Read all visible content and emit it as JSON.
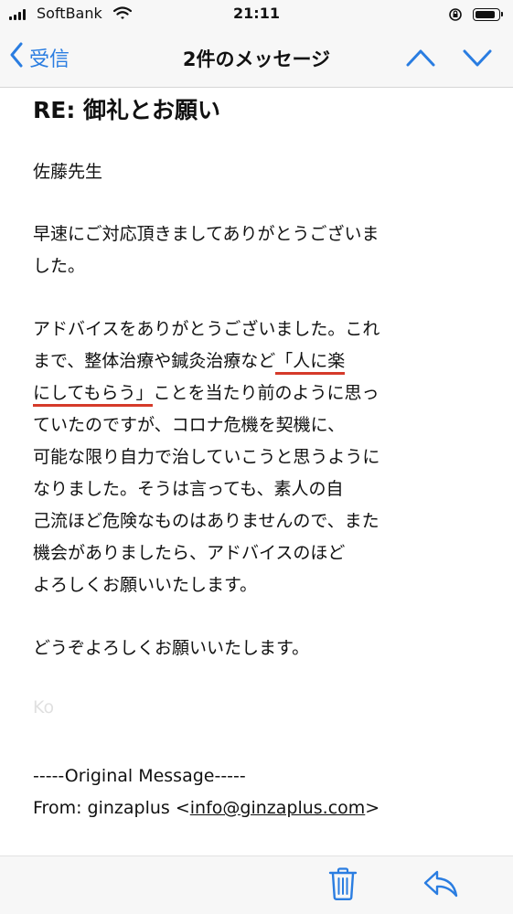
{
  "status_bar": {
    "carrier": "SoftBank",
    "time": "21:11",
    "battery_level": 0.92
  },
  "nav": {
    "back_label": "受信",
    "title": "2件のメッセージ"
  },
  "email": {
    "subject": "RE:  御礼とお願い",
    "greeting": "佐藤先生",
    "para1": [
      "早速にご対応頂きましてありがとうございま",
      "した。"
    ],
    "para2": {
      "l1": "アドバイスをありがとうございました。これ",
      "l2_pre": "まで、整体治療や鍼灸治療など",
      "l2_hl": "「人に楽",
      "l3_hl": "にしてもらう」",
      "l3_post": "ことを当たり前のように思っ",
      "l4": "ていたのですが、コロナ危機を契機に、",
      "l5": "可能な限り自力で治していこうと思うように",
      "l6": "なりました。そうは言っても、素人の自",
      "l7": "己流ほど危険なものはありませんので、また",
      "l8": "機会がありましたら、アドバイスのほど",
      "l9": "よろしくお願いいたします。"
    },
    "closing": "どうぞよろしくお願いいたします。",
    "faded_signature": "Ko",
    "original_divider": "-----Original Message-----",
    "from_label": "From: ginzaplus <",
    "from_email": "info@ginzaplus.com",
    "from_end": ">"
  },
  "colors": {
    "accent": "#2a7de1",
    "underline": "#d53a2a"
  },
  "icons": {
    "back": "chevron-left-icon",
    "up": "chevron-up-icon",
    "down": "chevron-down-icon",
    "trash": "trash-icon",
    "reply": "reply-icon",
    "wifi": "wifi-icon",
    "rotation_lock": "rotation-lock-icon",
    "battery": "battery-icon"
  }
}
